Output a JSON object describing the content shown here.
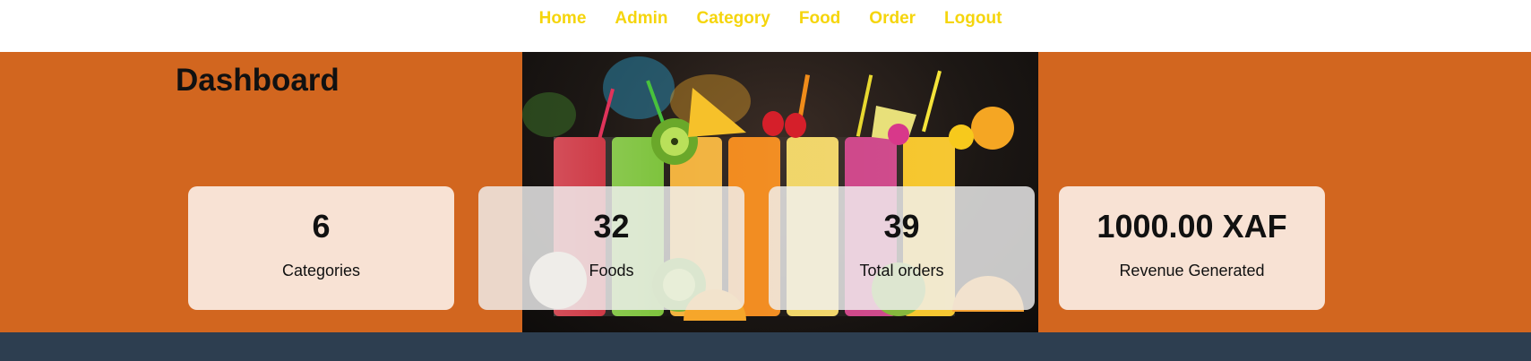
{
  "nav": {
    "items": [
      {
        "label": "Home"
      },
      {
        "label": "Admin"
      },
      {
        "label": "Category"
      },
      {
        "label": "Food"
      },
      {
        "label": "Order"
      },
      {
        "label": "Logout"
      }
    ]
  },
  "main": {
    "title": "Dashboard",
    "stats": [
      {
        "value": "6",
        "label": "Categories"
      },
      {
        "value": "32",
        "label": "Foods"
      },
      {
        "value": "39",
        "label": "Total orders"
      },
      {
        "value": "1000.00 XAF",
        "label": "Revenue Generated"
      }
    ]
  },
  "colors": {
    "nav_link": "#f5d50c",
    "hero_background": "#d2661f",
    "card_background": "#f8e2d4",
    "footer_background": "#2d3e50"
  }
}
